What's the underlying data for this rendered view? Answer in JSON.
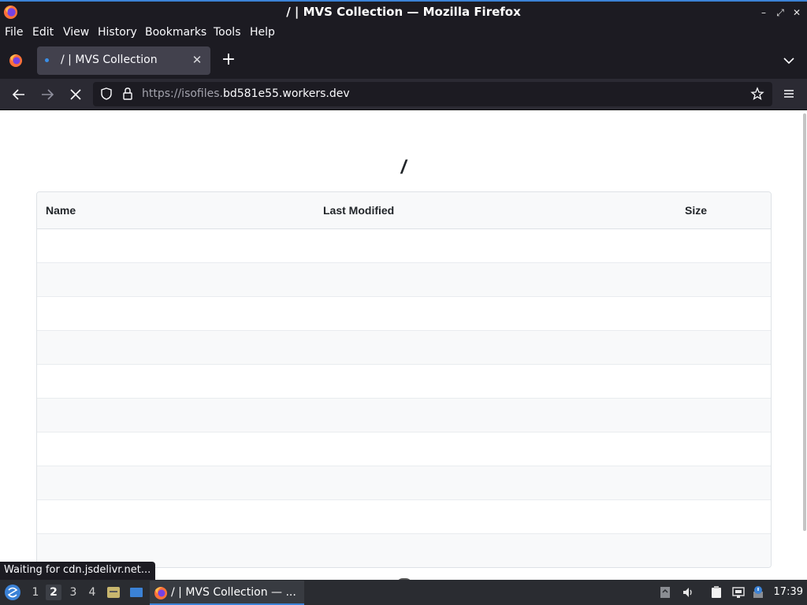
{
  "window": {
    "title": "/ | MVS Collection — Mozilla Firefox"
  },
  "menu": [
    {
      "label": "File"
    },
    {
      "label": "Edit"
    },
    {
      "label": "View"
    },
    {
      "label": "History"
    },
    {
      "label": "Bookmarks"
    },
    {
      "label": "Tools"
    },
    {
      "label": "Help"
    }
  ],
  "tab": {
    "title": "/ | MVS Collection"
  },
  "url": {
    "prefix": "https://isofiles.",
    "domain": "bd581e55.workers.dev"
  },
  "page": {
    "heading": "/",
    "columns": {
      "name": "Name",
      "modified": "Last Modified",
      "size": "Size"
    },
    "row_count": 10
  },
  "status": {
    "text": "Waiting for cdn.jsdelivr.net..."
  },
  "taskbar": {
    "workspaces": [
      "1",
      "2",
      "3",
      "4"
    ],
    "active_workspace": "2",
    "task_label": "/ | MVS Collection — ...",
    "clock": "17:39"
  },
  "colors": {
    "accent": "#3b82d6",
    "chrome": "#1c1b22",
    "toolbar": "#2b2a33",
    "table_header": "#f8f9fa"
  }
}
